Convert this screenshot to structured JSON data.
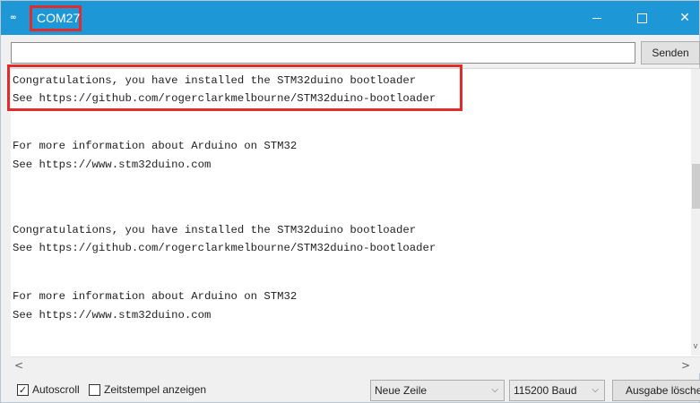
{
  "window": {
    "title": "COM27",
    "icon": "arduino-infinity-icon",
    "icon_glyph": "∞",
    "minimize_icon": "minimize-icon",
    "maximize_icon": "maximize-icon",
    "close_icon": "close-icon",
    "close_glyph": "✕"
  },
  "send": {
    "input_value": "",
    "button_label": "Senden"
  },
  "output": {
    "lines": [
      "Congratulations, you have installed the STM32duino bootloader",
      "See https://github.com/rogerclarkmelbourne/STM32duino-bootloader",
      "For more information about Arduino on STM32",
      "See https://www.stm32duino.com",
      "Congratulations, you have installed the STM32duino bootloader",
      "See https://github.com/rogerclarkmelbourne/STM32duino-bootloader",
      "For more information about Arduino on STM32",
      "See https://www.stm32duino.com"
    ],
    "highlight_color": "#e22b2b"
  },
  "scrollbar": {
    "left_glyph": "<",
    "right_glyph": ">",
    "down_glyph": "v"
  },
  "bottom": {
    "autoscroll_label": "Autoscroll",
    "autoscroll_checked": true,
    "check_glyph": "✓",
    "timestamp_label": "Zeitstempel anzeigen",
    "timestamp_checked": false,
    "line_ending_value": "Neue Zeile",
    "baud_value": "115200 Baud",
    "chevron_glyph": "⌵",
    "clear_label": "Ausgabe löschen"
  },
  "colors": {
    "titlebar": "#1e97d6",
    "highlight": "#e22b2b"
  }
}
